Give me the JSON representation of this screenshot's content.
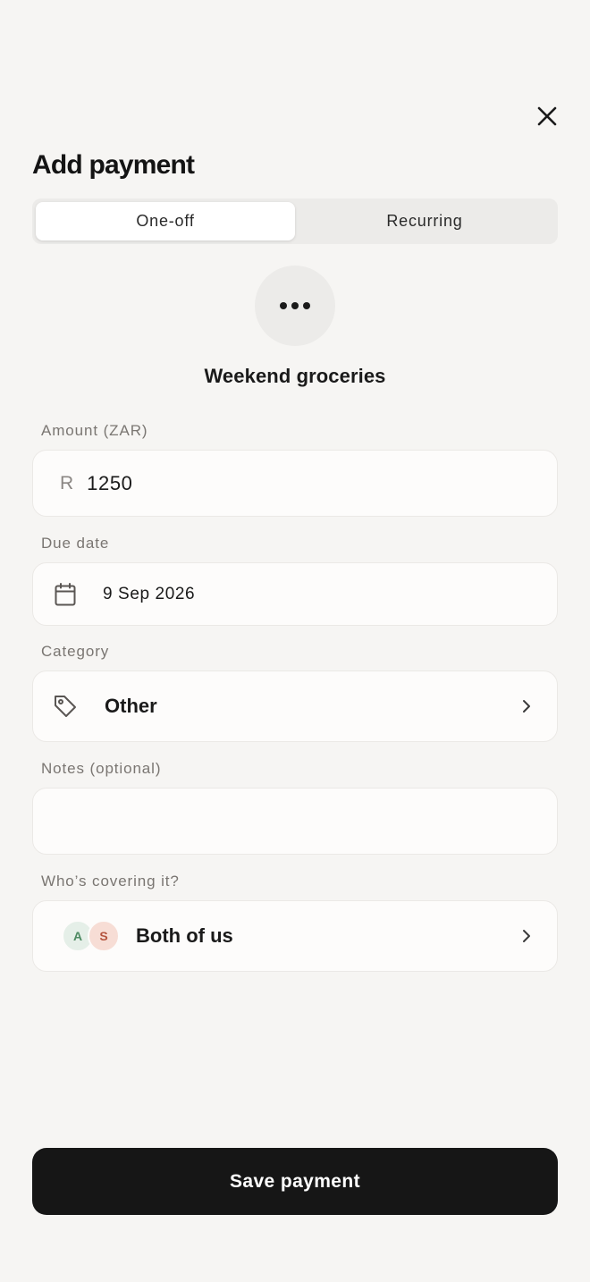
{
  "header": {
    "title": "Add payment",
    "close_icon": "close-icon"
  },
  "tabs": [
    {
      "label": "One-off",
      "active": true
    },
    {
      "label": "Recurring",
      "active": false
    }
  ],
  "payment": {
    "icon": "more-horizontal-icon",
    "name": "Weekend groceries"
  },
  "form": {
    "amount": {
      "label": "Amount (ZAR)",
      "currency_symbol": "R",
      "value": "1250"
    },
    "due_date": {
      "label": "Due date",
      "icon": "calendar-icon",
      "value": "9 Sep 2026"
    },
    "category": {
      "label": "Category",
      "icon": "tag-icon",
      "value": "Other"
    },
    "notes": {
      "label": "Notes (optional)",
      "value": ""
    },
    "covering": {
      "label": "Who’s covering it?",
      "avatars": [
        "A",
        "S"
      ],
      "value": "Both of us"
    }
  },
  "actions": {
    "save_label": "Save payment"
  },
  "colors": {
    "background": "#f6f5f3",
    "field_bg": "#fdfcfb",
    "primary_button": "#161616",
    "avatar_a": "#e5efe8",
    "avatar_s": "#f7ddd5"
  }
}
